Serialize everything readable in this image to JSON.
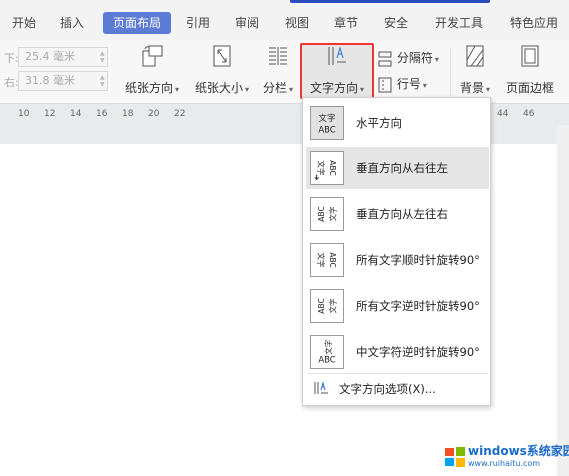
{
  "tabs": [
    {
      "label": "开始"
    },
    {
      "label": "插入"
    },
    {
      "label": "页面布局"
    },
    {
      "label": "引用"
    },
    {
      "label": "审阅"
    },
    {
      "label": "视图"
    },
    {
      "label": "章节"
    },
    {
      "label": "安全"
    },
    {
      "label": "开发工具"
    },
    {
      "label": "特色应用"
    }
  ],
  "active_tab": "页面布局",
  "ribbon": {
    "margin_bottom": {
      "label": "下:",
      "value": "25.4 毫米"
    },
    "margin_right": {
      "label": "右:",
      "value": "31.8 毫米"
    },
    "orientation": "纸张方向",
    "size": "纸张大小",
    "columns": "分栏",
    "text_direction": "文字方向",
    "separator": "分隔符",
    "line_numbers": "行号",
    "background": "背景",
    "page_border": "页面边框"
  },
  "ruler_numbers": [
    "10",
    "12",
    "14",
    "16",
    "18",
    "20",
    "22",
    "44",
    "46"
  ],
  "menu": {
    "items": [
      {
        "label": "水平方向",
        "icon": "horizontal-text-icon"
      },
      {
        "label": "垂直方向从右往左",
        "icon": "vertical-rtl-icon"
      },
      {
        "label": "垂直方向从左往右",
        "icon": "vertical-ltr-icon"
      },
      {
        "label": "所有文字顺时针旋转90°",
        "icon": "rotate-cw-icon"
      },
      {
        "label": "所有文字逆时针旋转90°",
        "icon": "rotate-ccw-icon"
      },
      {
        "label": "中文字符逆时针旋转90°",
        "icon": "cjk-rotate-ccw-icon"
      }
    ],
    "options": "文字方向选项(X)..."
  },
  "watermark": {
    "title": "windows系统家园",
    "url": "www.ruihaitu.com"
  },
  "colors": {
    "accent": "#5b7bd5",
    "highlight_border": "#e33333",
    "brand_blue": "#2b4bbf"
  }
}
